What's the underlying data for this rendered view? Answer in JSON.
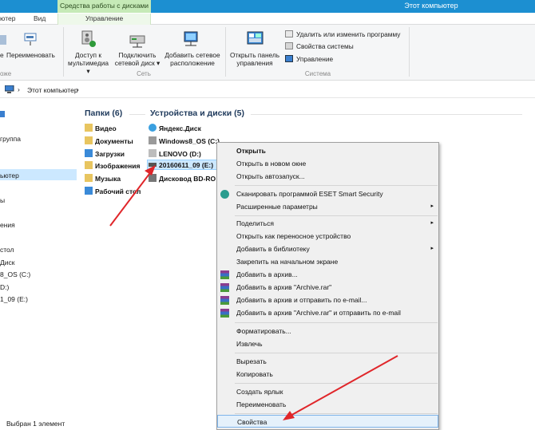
{
  "title_bar": {
    "context_tab": "Средства работы с дисками",
    "window_title": "Этот компьютер"
  },
  "tabs": [
    {
      "label": "ютер"
    },
    {
      "label": "Вид"
    },
    {
      "label": "Управление"
    }
  ],
  "ribbon": {
    "left_button": "Переименовать",
    "left_group_label": "оже",
    "network_buttons": [
      {
        "line1": "Доступ к",
        "line2": "мультимедиа ▾"
      },
      {
        "line1": "Подключить",
        "line2": "сетевой диск ▾"
      },
      {
        "line1": "Добавить сетевое",
        "line2": "расположение"
      }
    ],
    "network_group_label": "Сеть",
    "control_panel": {
      "line1": "Открыть панель",
      "line2": "управления"
    },
    "system_items": [
      "Удалить или изменить программу",
      "Свойства системы",
      "Управление"
    ],
    "system_group_label": "Система"
  },
  "address": {
    "path": "Этот компьютер",
    "separator": "›"
  },
  "nav_pane": [
    "группа",
    "ьютер",
    "ы",
    "ения",
    "стол",
    "Диск",
    "8_OS (C:)",
    "D:)",
    "1_09 (E:)"
  ],
  "folders": {
    "header": "Папки",
    "count": "(6)",
    "items": [
      "Видео",
      "Документы",
      "Загрузки",
      "Изображения",
      "Музыка",
      "Рабочий стол"
    ]
  },
  "devices": {
    "header": "Устройства и диски",
    "count": "(5)",
    "items": [
      "Яндекс.Диск",
      "Windows8_OS (C:)",
      "LENOVO (D:)",
      "20160611_09 (E:)",
      "Дисковод BD-RO"
    ]
  },
  "status_bar": {
    "text": "Выбран 1 элемент"
  },
  "context_menu": {
    "items": [
      {
        "label": "Открыть",
        "bold": true
      },
      {
        "label": "Открыть в новом окне"
      },
      {
        "label": "Открыть автозапуск..."
      },
      {
        "label": "Сканировать программой ESET Smart Security",
        "icon": "eset-icon"
      },
      {
        "label": "Расширенные параметры",
        "submenu": true
      },
      {
        "label": "Поделиться",
        "submenu": true
      },
      {
        "label": "Открыть как переносное устройство"
      },
      {
        "label": "Добавить в библиотеку",
        "submenu": true
      },
      {
        "label": "Закрепить на начальном экране"
      },
      {
        "label": "Добавить в архив...",
        "icon": "winrar-icon"
      },
      {
        "label": "Добавить в архив \"Archive.rar\"",
        "icon": "winrar-icon"
      },
      {
        "label": "Добавить в архив и отправить по e-mail...",
        "icon": "winrar-icon"
      },
      {
        "label": "Добавить в архив \"Archive.rar\" и отправить по e-mail",
        "icon": "winrar-icon"
      },
      {
        "label": "Форматировать..."
      },
      {
        "label": "Извлечь"
      },
      {
        "label": "Вырезать"
      },
      {
        "label": "Копировать"
      },
      {
        "label": "Создать ярлык"
      },
      {
        "label": "Переименовать"
      },
      {
        "label": "Свойства",
        "highlighted": true
      }
    ],
    "submenu_arrow": "▸"
  },
  "colors": {
    "title_bar": "#1c8fd1",
    "context_tab": "#c6eab7",
    "selection": "#cce8ff",
    "annotation_arrow": "#e0262a"
  }
}
